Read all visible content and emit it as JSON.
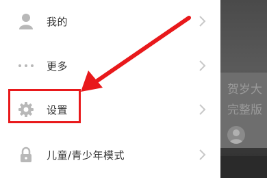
{
  "menu": {
    "items": [
      {
        "label": "我的",
        "icon": "person-icon"
      },
      {
        "label": "更多",
        "icon": "more-dots-icon"
      },
      {
        "label": "设置",
        "icon": "gear-icon"
      },
      {
        "label": "儿童/青少年模式",
        "icon": "lock-icon"
      }
    ]
  },
  "background_content": {
    "line1": "贺岁大",
    "line2": "完整版"
  },
  "annotation": {
    "highlight_color": "#e8191b"
  }
}
